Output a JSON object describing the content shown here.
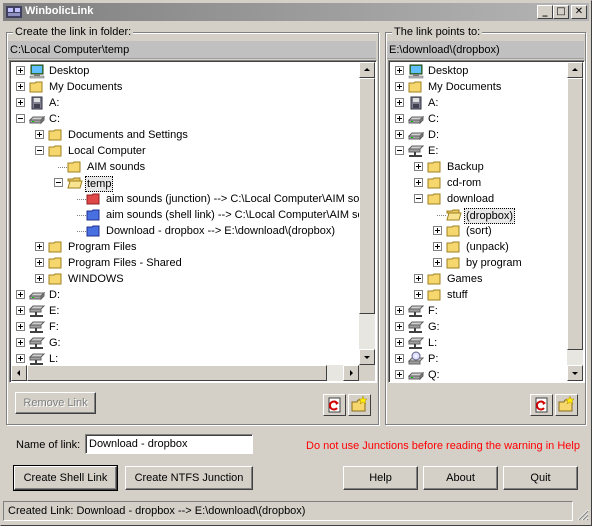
{
  "window": {
    "title": "WinbolicLink",
    "minimize": "_",
    "maximize": "□",
    "close": "✕"
  },
  "left_panel": {
    "group_label": "Create the link in folder:",
    "path": "C:\\Local Computer\\temp",
    "tree": [
      {
        "label": "Desktop",
        "icon": "desktop-icon",
        "expander": "plus",
        "level": 0
      },
      {
        "label": "My Documents",
        "icon": "folder-icon",
        "expander": "plus",
        "level": 0
      },
      {
        "label": "A:",
        "icon": "floppy-drive-icon",
        "expander": "plus",
        "level": 0
      },
      {
        "label": "C:",
        "icon": "hard-drive-icon",
        "expander": "minus",
        "level": 0
      },
      {
        "label": "Documents and Settings",
        "icon": "folder-icon",
        "expander": "plus",
        "level": 1
      },
      {
        "label": "Local Computer",
        "icon": "folder-icon",
        "expander": "minus",
        "level": 1
      },
      {
        "label": "AIM sounds",
        "icon": "folder-icon",
        "expander": "none",
        "level": 2
      },
      {
        "label": "temp",
        "icon": "open-folder-icon",
        "expander": "minus",
        "level": 2,
        "selected": true
      },
      {
        "label": "aim sounds (junction) --> C:\\Local Computer\\AIM sou",
        "icon": "red-folder-icon",
        "expander": "none",
        "level": 3
      },
      {
        "label": "aim sounds (shell link) --> C:\\Local Computer\\AIM so",
        "icon": "blue-folder-icon",
        "expander": "none",
        "level": 3
      },
      {
        "label": "Download - dropbox --> E:\\download\\(dropbox)",
        "icon": "blue-folder-icon",
        "expander": "none",
        "level": 3
      },
      {
        "label": "Program Files",
        "icon": "folder-icon",
        "expander": "plus",
        "level": 1
      },
      {
        "label": "Program Files - Shared",
        "icon": "folder-icon",
        "expander": "plus",
        "level": 1
      },
      {
        "label": "WINDOWS",
        "icon": "folder-icon",
        "expander": "plus",
        "level": 1
      },
      {
        "label": "D:",
        "icon": "hard-drive-icon",
        "expander": "plus",
        "level": 0
      },
      {
        "label": "E:",
        "icon": "network-drive-icon",
        "expander": "plus",
        "level": 0
      },
      {
        "label": "F:",
        "icon": "network-drive-icon",
        "expander": "plus",
        "level": 0
      },
      {
        "label": "G:",
        "icon": "network-drive-icon",
        "expander": "plus",
        "level": 0
      },
      {
        "label": "L:",
        "icon": "network-drive-icon",
        "expander": "plus",
        "level": 0
      }
    ],
    "remove_link": "Remove Link"
  },
  "right_panel": {
    "group_label": "The link points to:",
    "path": "E:\\download\\(dropbox)",
    "tree": [
      {
        "label": "Desktop",
        "icon": "desktop-icon",
        "expander": "plus",
        "level": 0
      },
      {
        "label": "My Documents",
        "icon": "folder-icon",
        "expander": "plus",
        "level": 0
      },
      {
        "label": "A:",
        "icon": "floppy-drive-icon",
        "expander": "plus",
        "level": 0
      },
      {
        "label": "C:",
        "icon": "hard-drive-icon",
        "expander": "plus",
        "level": 0
      },
      {
        "label": "D:",
        "icon": "hard-drive-icon",
        "expander": "plus",
        "level": 0
      },
      {
        "label": "E:",
        "icon": "network-drive-icon",
        "expander": "minus",
        "level": 0
      },
      {
        "label": "Backup",
        "icon": "folder-icon",
        "expander": "plus",
        "level": 1
      },
      {
        "label": "cd-rom",
        "icon": "folder-icon",
        "expander": "plus",
        "level": 1
      },
      {
        "label": "download",
        "icon": "folder-icon",
        "expander": "minus",
        "level": 1
      },
      {
        "label": "(dropbox)",
        "icon": "open-folder-icon",
        "expander": "none",
        "level": 2,
        "selected": true
      },
      {
        "label": "(sort)",
        "icon": "folder-icon",
        "expander": "plus",
        "level": 2
      },
      {
        "label": "(unpack)",
        "icon": "folder-icon",
        "expander": "plus",
        "level": 2
      },
      {
        "label": "by program",
        "icon": "folder-icon",
        "expander": "plus",
        "level": 2
      },
      {
        "label": "Games",
        "icon": "folder-icon",
        "expander": "plus",
        "level": 1
      },
      {
        "label": "stuff",
        "icon": "folder-icon",
        "expander": "plus",
        "level": 1
      },
      {
        "label": "F:",
        "icon": "network-drive-icon",
        "expander": "plus",
        "level": 0
      },
      {
        "label": "G:",
        "icon": "network-drive-icon",
        "expander": "plus",
        "level": 0
      },
      {
        "label": "L:",
        "icon": "network-drive-icon",
        "expander": "plus",
        "level": 0
      },
      {
        "label": "P:",
        "icon": "cd-drive-icon",
        "expander": "plus",
        "level": 0
      },
      {
        "label": "Q:",
        "icon": "hard-drive-icon",
        "expander": "plus",
        "level": 0
      }
    ]
  },
  "form": {
    "name_label": "Name of link:",
    "name_value": "Download - dropbox",
    "warning": "Do not use Junctions before reading the warning in Help",
    "warning_color": "#ff0000"
  },
  "buttons": {
    "create_shell_link": "Create Shell Link",
    "create_ntfs_junction": "Create NTFS Junction",
    "help": "Help",
    "about": "About",
    "quit": "Quit"
  },
  "status": {
    "text": "Created Link: Download - dropbox --> E:\\download\\(dropbox)"
  }
}
